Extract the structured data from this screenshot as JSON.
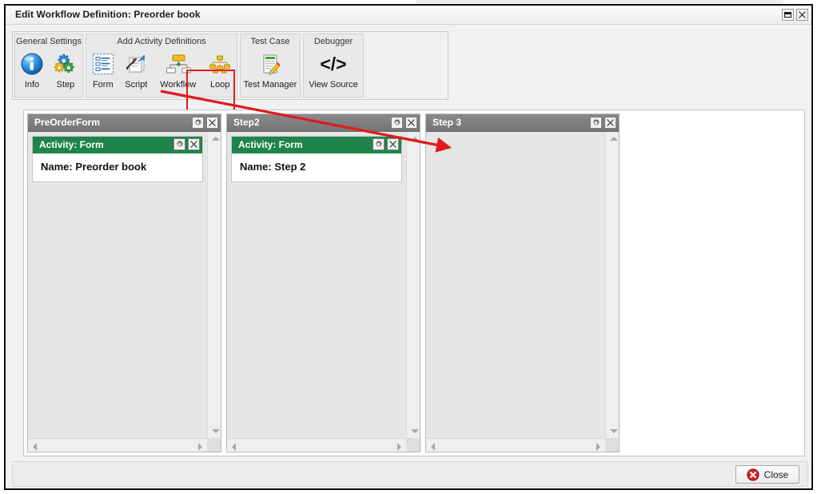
{
  "window": {
    "title": "Edit Workflow Definition: Preorder book",
    "maximize_icon": "maximize-icon",
    "close_icon": "close-icon"
  },
  "background": {
    "strip_left_text": "",
    "strip_right_text": ""
  },
  "ribbon": {
    "groups": [
      {
        "title": "General Settings",
        "name": "general-settings",
        "items": [
          {
            "label": "Info",
            "icon": "info-icon"
          },
          {
            "label": "Step",
            "icon": "gears-icon"
          }
        ]
      },
      {
        "title": "Add Activity Definitions",
        "name": "add-activity-definitions",
        "items": [
          {
            "label": "Form",
            "icon": "form-icon"
          },
          {
            "label": "Script",
            "icon": "script-icon"
          },
          {
            "label": "Workflow",
            "icon": "workflow-icon"
          },
          {
            "label": "Loop",
            "icon": "loop-icon"
          }
        ]
      },
      {
        "title": "Test Case",
        "name": "test-case",
        "items": [
          {
            "label": "Test Manager",
            "icon": "test-manager-icon"
          }
        ]
      },
      {
        "title": "Debugger",
        "name": "debugger",
        "items": [
          {
            "label": "View Source",
            "icon": "code-icon"
          }
        ]
      }
    ],
    "highlight_color": "#e01b1b",
    "highlighted_item": "Form"
  },
  "workspace": {
    "panels": [
      {
        "title": "PreOrderForm",
        "gear_icon": "gear-icon",
        "close_icon": "close-icon",
        "activity": {
          "title": "Activity: Form",
          "name_label": "Name: Preorder book",
          "gear_icon": "gear-icon",
          "close_icon": "close-icon"
        }
      },
      {
        "title": "Step2",
        "gear_icon": "gear-icon",
        "close_icon": "close-icon",
        "activity": {
          "title": "Activity: Form",
          "name_label": "Name: Step 2",
          "gear_icon": "gear-icon",
          "close_icon": "close-icon"
        }
      },
      {
        "title": "Step 3",
        "gear_icon": "gear-icon",
        "close_icon": "close-icon",
        "activity": null
      }
    ]
  },
  "footer": {
    "close_label": "Close",
    "close_icon": "error-circle-icon"
  },
  "annotation": {
    "arrow_color": "#e01b1b",
    "from": "Form button",
    "to": "Step 3 panel"
  },
  "colors": {
    "activity_green": "#1e8449",
    "panel_header_gray": "#7a7a7a",
    "annotation_red": "#e01b1b"
  }
}
